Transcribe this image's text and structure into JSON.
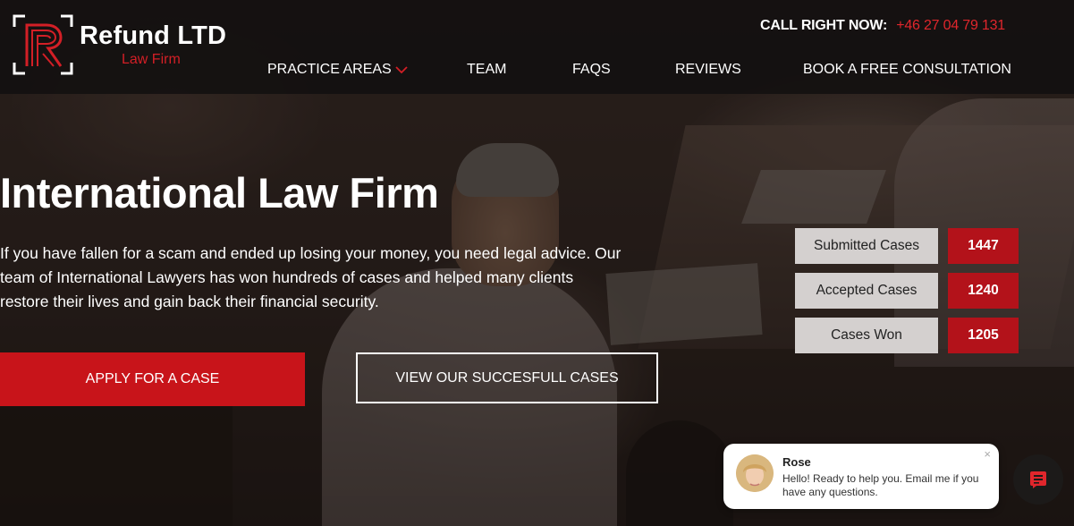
{
  "brand": {
    "name": "Refund LTD",
    "tagline": "Law Firm",
    "accent": "#d31f26"
  },
  "header": {
    "call_label": "CALL RIGHT NOW:",
    "call_number": "+46 27 04 79 131"
  },
  "nav": {
    "items": [
      {
        "label": "PRACTICE AREAS",
        "icon": "chevron-down-icon"
      },
      {
        "label": "TEAM"
      },
      {
        "label": "FAQS"
      },
      {
        "label": "REVIEWS"
      },
      {
        "label": "BOOK A FREE CONSULTATION"
      }
    ]
  },
  "hero": {
    "title": "International Law Firm",
    "text": "If you have fallen for a scam and ended up losing your money, you need legal advice. Our team of International Lawyers has won hundreds of cases and helped many clients restore their lives and gain back their financial security.",
    "apply_label": "APPLY FOR A CASE",
    "view_label": "VIEW OUR SUCCESFULL CASES"
  },
  "stats": [
    {
      "label": "Submitted Cases",
      "value": "1447"
    },
    {
      "label": "Accepted Cases",
      "value": "1240"
    },
    {
      "label": "Cases Won",
      "value": "1205"
    }
  ],
  "chat": {
    "name": "Rose",
    "message": "Hello! Ready to help you. Email me if you have any questions.",
    "close_glyph": "×",
    "launcher_icon": "chat-icon"
  }
}
